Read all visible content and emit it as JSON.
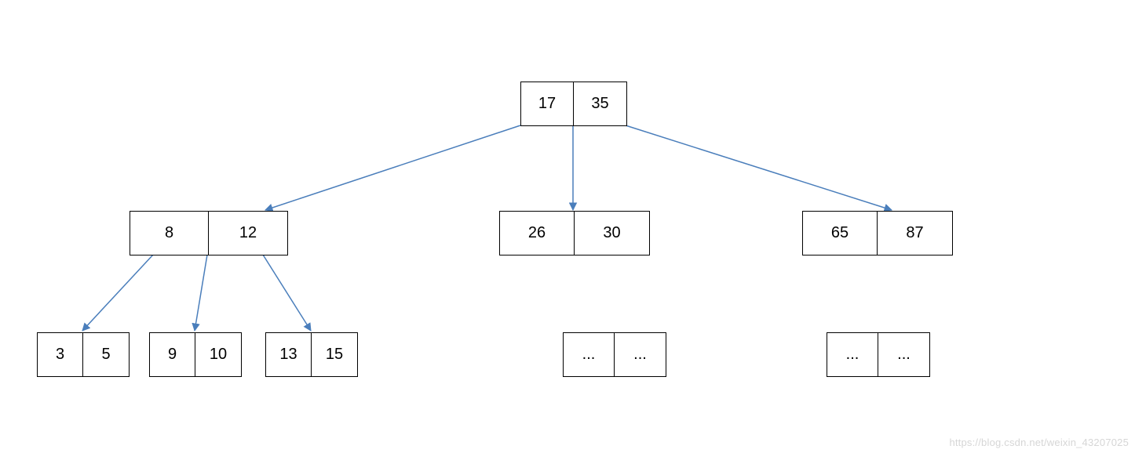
{
  "tree": {
    "root": {
      "keys": [
        "17",
        "35"
      ]
    },
    "level1": {
      "left": {
        "keys": [
          "8",
          "12"
        ]
      },
      "middle": {
        "keys": [
          "26",
          "30"
        ]
      },
      "right": {
        "keys": [
          "65",
          "87"
        ]
      }
    },
    "level2": {
      "leftChildren": [
        {
          "keys": [
            "3",
            "5"
          ]
        },
        {
          "keys": [
            "9",
            "10"
          ]
        },
        {
          "keys": [
            "13",
            "15"
          ]
        }
      ],
      "middlePlaceholder": {
        "keys": [
          "...",
          "..."
        ]
      },
      "rightPlaceholder": {
        "keys": [
          "...",
          "..."
        ]
      }
    }
  },
  "watermark": "https://blog.csdn.net/weixin_43207025",
  "colors": {
    "edge": "#4a7ebb"
  }
}
